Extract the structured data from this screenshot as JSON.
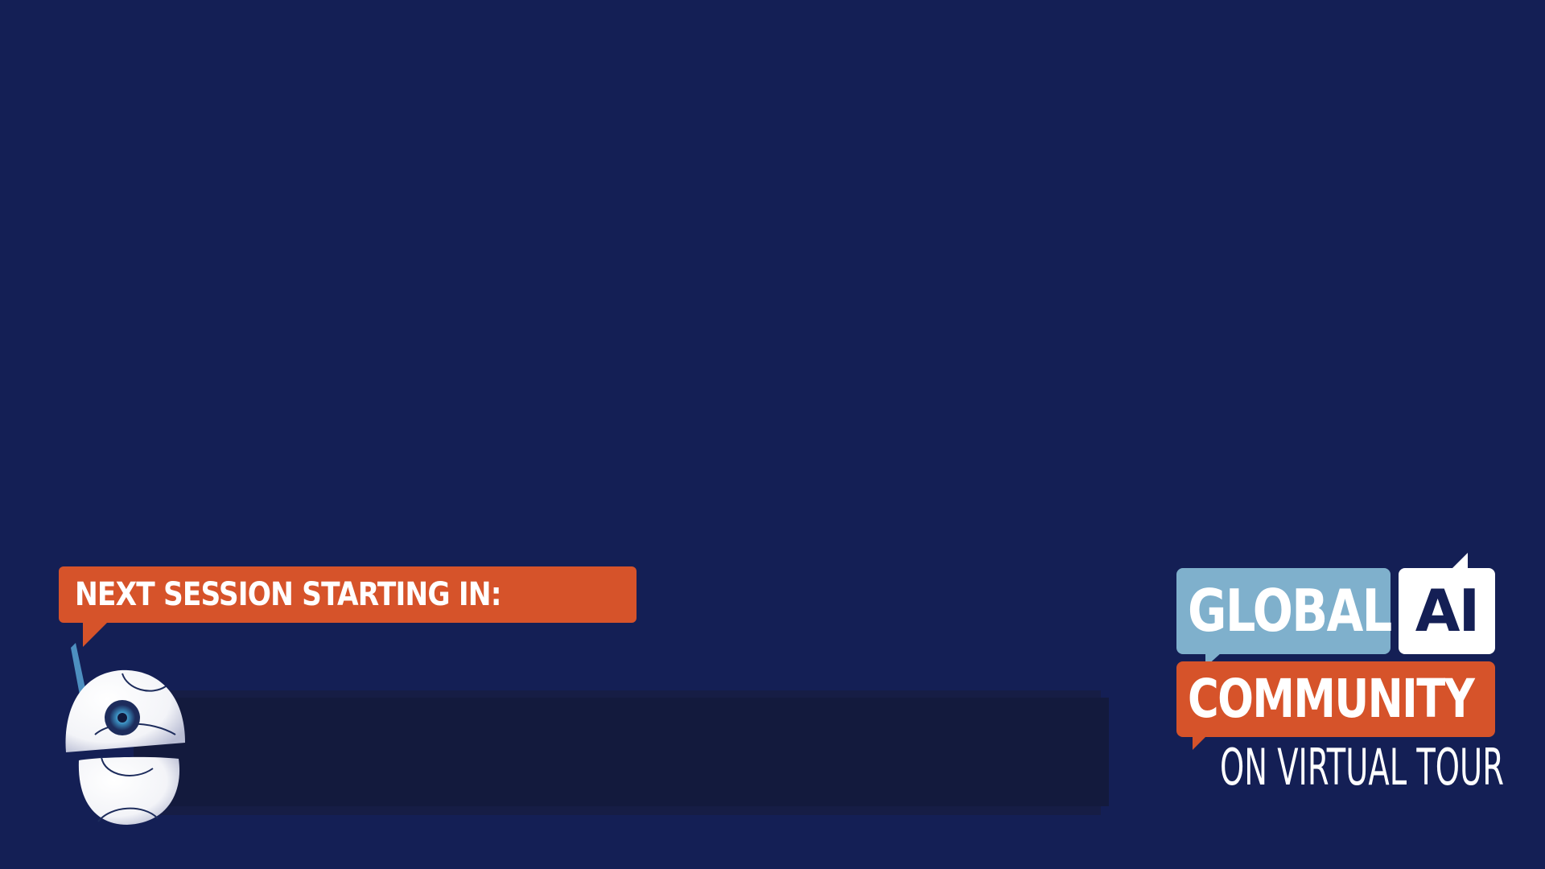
{
  "banner": {
    "label": "NEXT SESSION STARTING IN:"
  },
  "countdown": {
    "value": ""
  },
  "logo": {
    "line1_left": "GLOBAL",
    "line1_right": "AI",
    "line2": "COMMUNITY",
    "line3": "ON VIRTUAL TOUR"
  },
  "colors": {
    "background": "#141f55",
    "accent_orange": "#d6532a",
    "accent_light_blue": "#7fb0cc",
    "countdown_bar": "#131a3d",
    "text_white": "#ffffff"
  },
  "icons": {
    "mascot": "robot-mascot-icon"
  }
}
